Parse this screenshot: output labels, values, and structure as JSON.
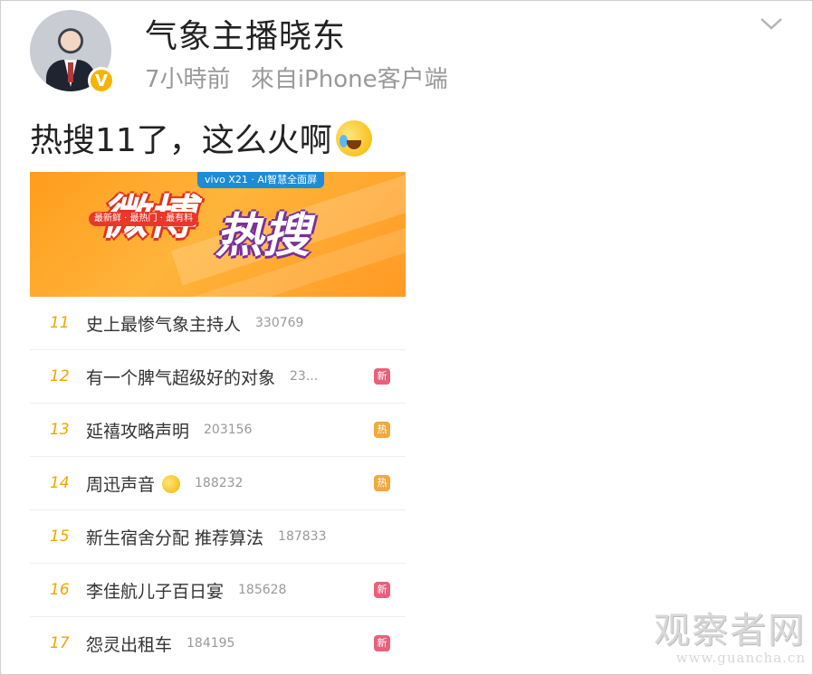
{
  "post": {
    "username": "气象主播晓东",
    "time": "7小時前",
    "source": "來自iPhone客户端",
    "text": "热搜11了，这么火啊",
    "text_emoji": "laugh-cry-emoji"
  },
  "banner": {
    "tag": "vivo X21 · AI智慧全面屏",
    "title_weibo": "微博",
    "title_resou": "热搜",
    "subtag": "最新鲜 · 最热门 · 最有料"
  },
  "hot_list": [
    {
      "rank": "11",
      "title": "史上最惨气象主持人",
      "count": "330769",
      "tag": "",
      "emoji": false
    },
    {
      "rank": "12",
      "title": "有一个脾气超级好的对象",
      "count": "23...",
      "tag": "新",
      "tag_color": "#e8607a",
      "emoji": false
    },
    {
      "rank": "13",
      "title": "延禧攻略声明",
      "count": "203156",
      "tag": "热",
      "tag_color": "#f2a93b",
      "emoji": false
    },
    {
      "rank": "14",
      "title": "周迅声音",
      "count": "188232",
      "tag": "热",
      "tag_color": "#f2a93b",
      "emoji": true
    },
    {
      "rank": "15",
      "title": "新生宿舍分配 推荐算法",
      "count": "187833",
      "tag": "",
      "emoji": false
    },
    {
      "rank": "16",
      "title": "李佳航儿子百日宴",
      "count": "185628",
      "tag": "新",
      "tag_color": "#e8607a",
      "emoji": false
    },
    {
      "rank": "17",
      "title": "怨灵出租车",
      "count": "184195",
      "tag": "新",
      "tag_color": "#e8607a",
      "emoji": false
    }
  ],
  "watermark": {
    "title": "观察者网",
    "url": "www.guancha.cn"
  },
  "colors": {
    "rank": "#f0a500",
    "verified_badge": "#f5b400",
    "banner": "#ff9d1e"
  }
}
